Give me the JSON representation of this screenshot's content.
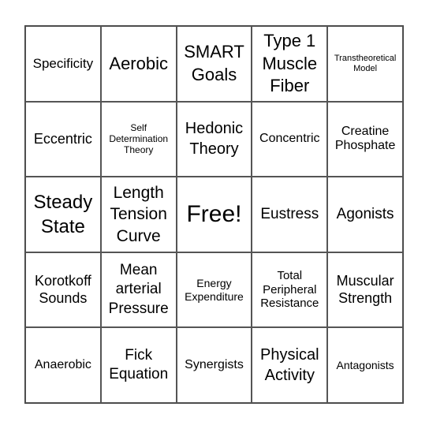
{
  "cells": [
    "Specificity",
    "Aerobic",
    "SMART\nGoals",
    "Type 1\nMuscle\nFiber",
    "Transtheoretical\nModel",
    "Eccentric",
    "Self\nDetermination\nTheory",
    "Hedonic\nTheory",
    "Concentric",
    "Creatine\nPhosphate",
    "Steady\nState",
    "Length\nTension\nCurve",
    "Free!",
    "Eustress",
    "Agonists",
    "Korotkoff\nSounds",
    "Mean\narterial\nPressure",
    "Energy\nExpenditure",
    "Total\nPeripheral\nResistance",
    "Muscular\nStrength",
    "Anaerobic",
    "Fick\nEquation",
    "Synergists",
    "Physical\nActivity",
    "Antagonists"
  ]
}
